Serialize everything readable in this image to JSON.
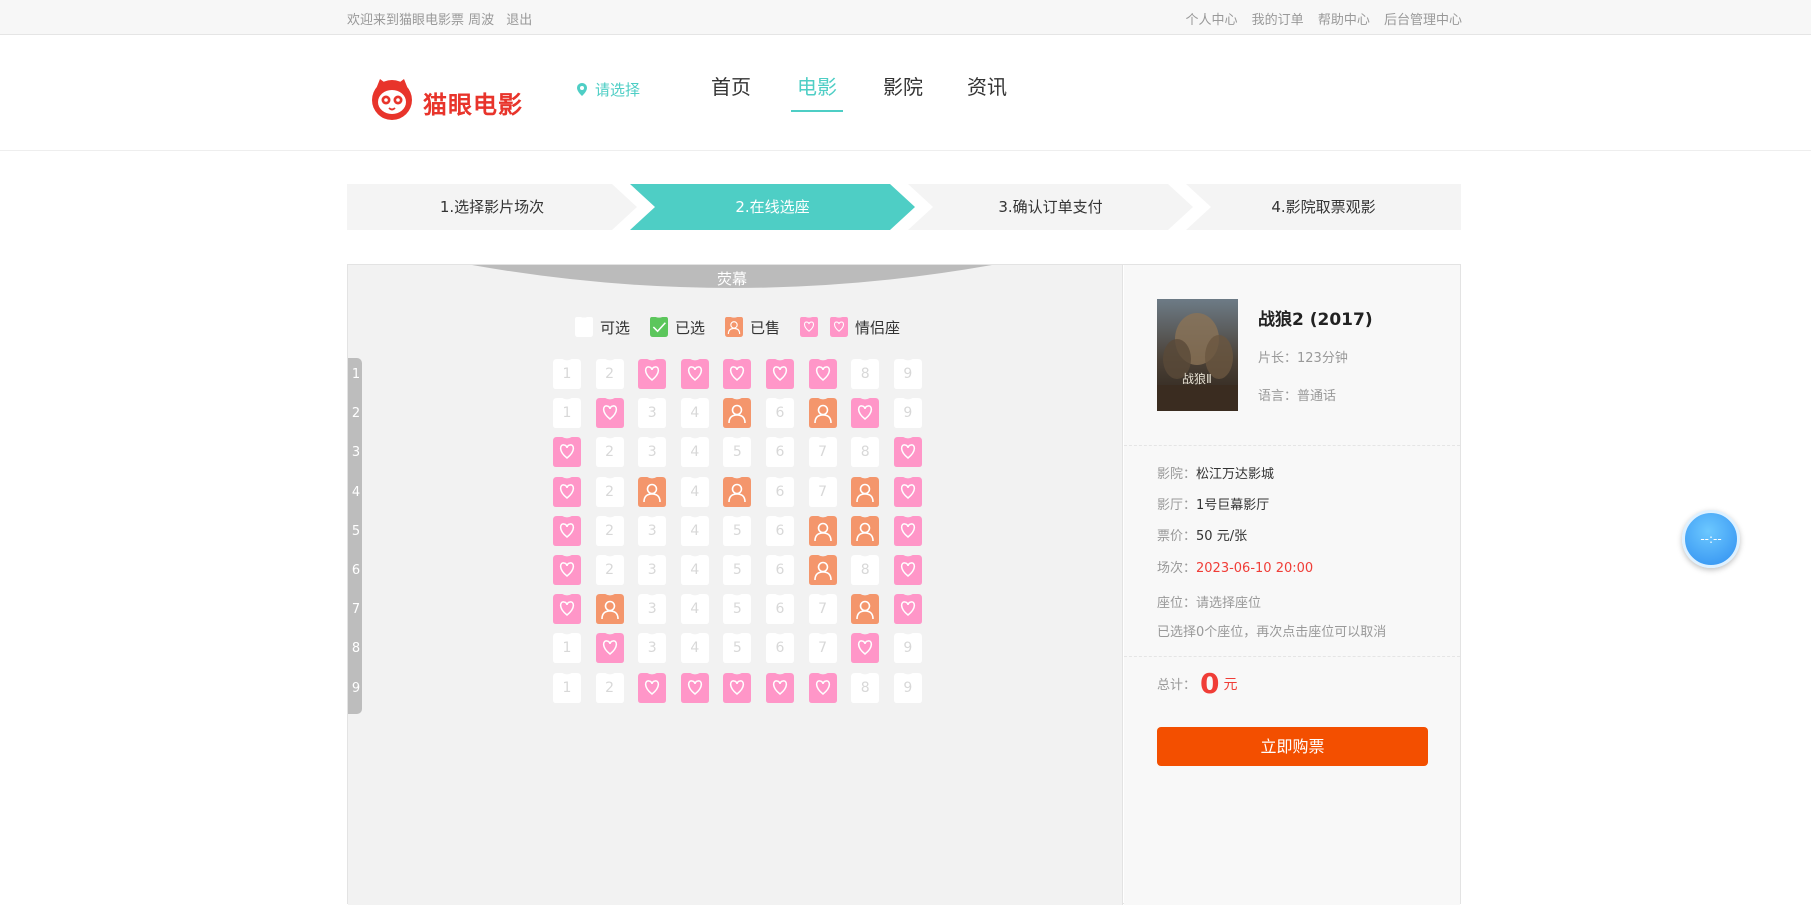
{
  "topbar": {
    "welcome": "欢迎来到猫眼电影票 周波",
    "logout": "退出",
    "links": [
      "个人中心",
      "我的订单",
      "帮助中心",
      "后台管理中心"
    ]
  },
  "header": {
    "logo_text": "猫眼电影",
    "city": "请选择",
    "nav": [
      "首页",
      "电影",
      "影院",
      "资讯"
    ],
    "active_nav": "电影"
  },
  "steps": [
    "1.选择影片场次",
    "2.在线选座",
    "3.确认订单支付",
    "4.影院取票观影"
  ],
  "active_step": 1,
  "hall": {
    "screen_label": "荧幕",
    "legend": {
      "available": "可选",
      "selected": "已选",
      "sold": "已售",
      "couple": "情侣座"
    },
    "rows": [
      "1",
      "2",
      "3",
      "4",
      "5",
      "6",
      "7",
      "8",
      "9"
    ],
    "seats": [
      [
        "1",
        "2",
        "C",
        "C",
        "C",
        "C",
        "C",
        "8",
        "9"
      ],
      [
        "1",
        "C",
        "3",
        "4",
        "S",
        "6",
        "S",
        "C",
        "9"
      ],
      [
        "C",
        "2",
        "3",
        "4",
        "5",
        "6",
        "7",
        "8",
        "C"
      ],
      [
        "C",
        "2",
        "S",
        "4",
        "S",
        "6",
        "7",
        "S",
        "C"
      ],
      [
        "C",
        "2",
        "3",
        "4",
        "5",
        "6",
        "S",
        "S",
        "C"
      ],
      [
        "C",
        "2",
        "3",
        "4",
        "5",
        "6",
        "S",
        "8",
        "C"
      ],
      [
        "C",
        "S",
        "3",
        "4",
        "5",
        "6",
        "7",
        "S",
        "C"
      ],
      [
        "1",
        "C",
        "3",
        "4",
        "5",
        "6",
        "7",
        "C",
        "9"
      ],
      [
        "1",
        "2",
        "C",
        "C",
        "C",
        "C",
        "C",
        "8",
        "9"
      ]
    ]
  },
  "movie": {
    "title": "战狼2 (2017)",
    "duration_label": "片长：",
    "duration": "123分钟",
    "language_label": "语言：",
    "language": "普通话",
    "poster_text": "战狼Ⅱ"
  },
  "order": {
    "cinema_label": "影院：",
    "cinema": "松江万达影城",
    "hall_label": "影厅：",
    "hall": "1号巨幕影厅",
    "price_label": "票价：",
    "price": "50 元/张",
    "time_label": "场次：",
    "time": "2023-06-10 20:00",
    "seat_label": "座位：",
    "seat": "请选择座位",
    "hint": "已选择0个座位，再次点击座位可以取消",
    "total_label": "总计：",
    "total": "0",
    "unit": "元",
    "buy": "立即购票"
  },
  "float_button": "--:--",
  "colors": {
    "accent": "#4ecec5",
    "couple": "#ff96c8",
    "sold": "#f4966c",
    "selected": "#5cc65c",
    "buy": "#f34f00",
    "price_red": "#f03d37"
  }
}
